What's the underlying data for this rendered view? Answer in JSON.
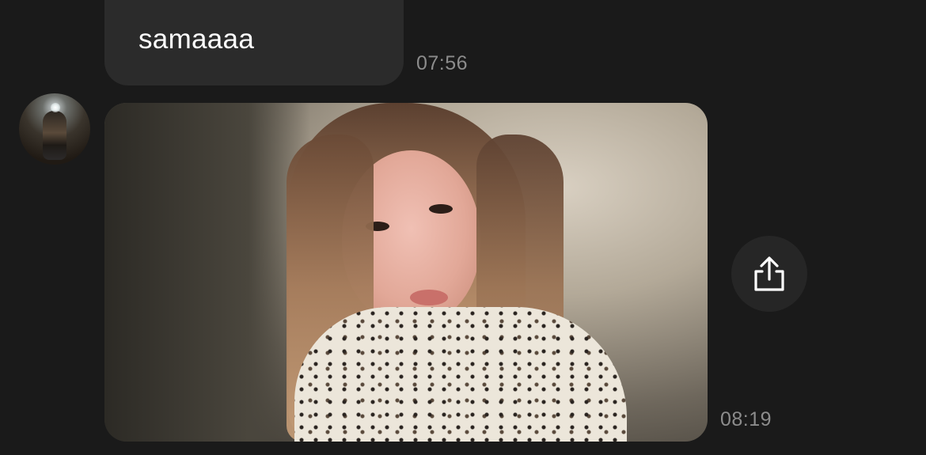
{
  "messages": [
    {
      "type": "text",
      "text": "samaaaa",
      "time": "07:56"
    },
    {
      "type": "image",
      "time": "08:19"
    }
  ],
  "icons": {
    "share": "share-icon"
  },
  "colors": {
    "background": "#1a1a1a",
    "bubble": "#2b2b2b",
    "timestamp": "#8c8c8c",
    "share_button": "#262626"
  }
}
